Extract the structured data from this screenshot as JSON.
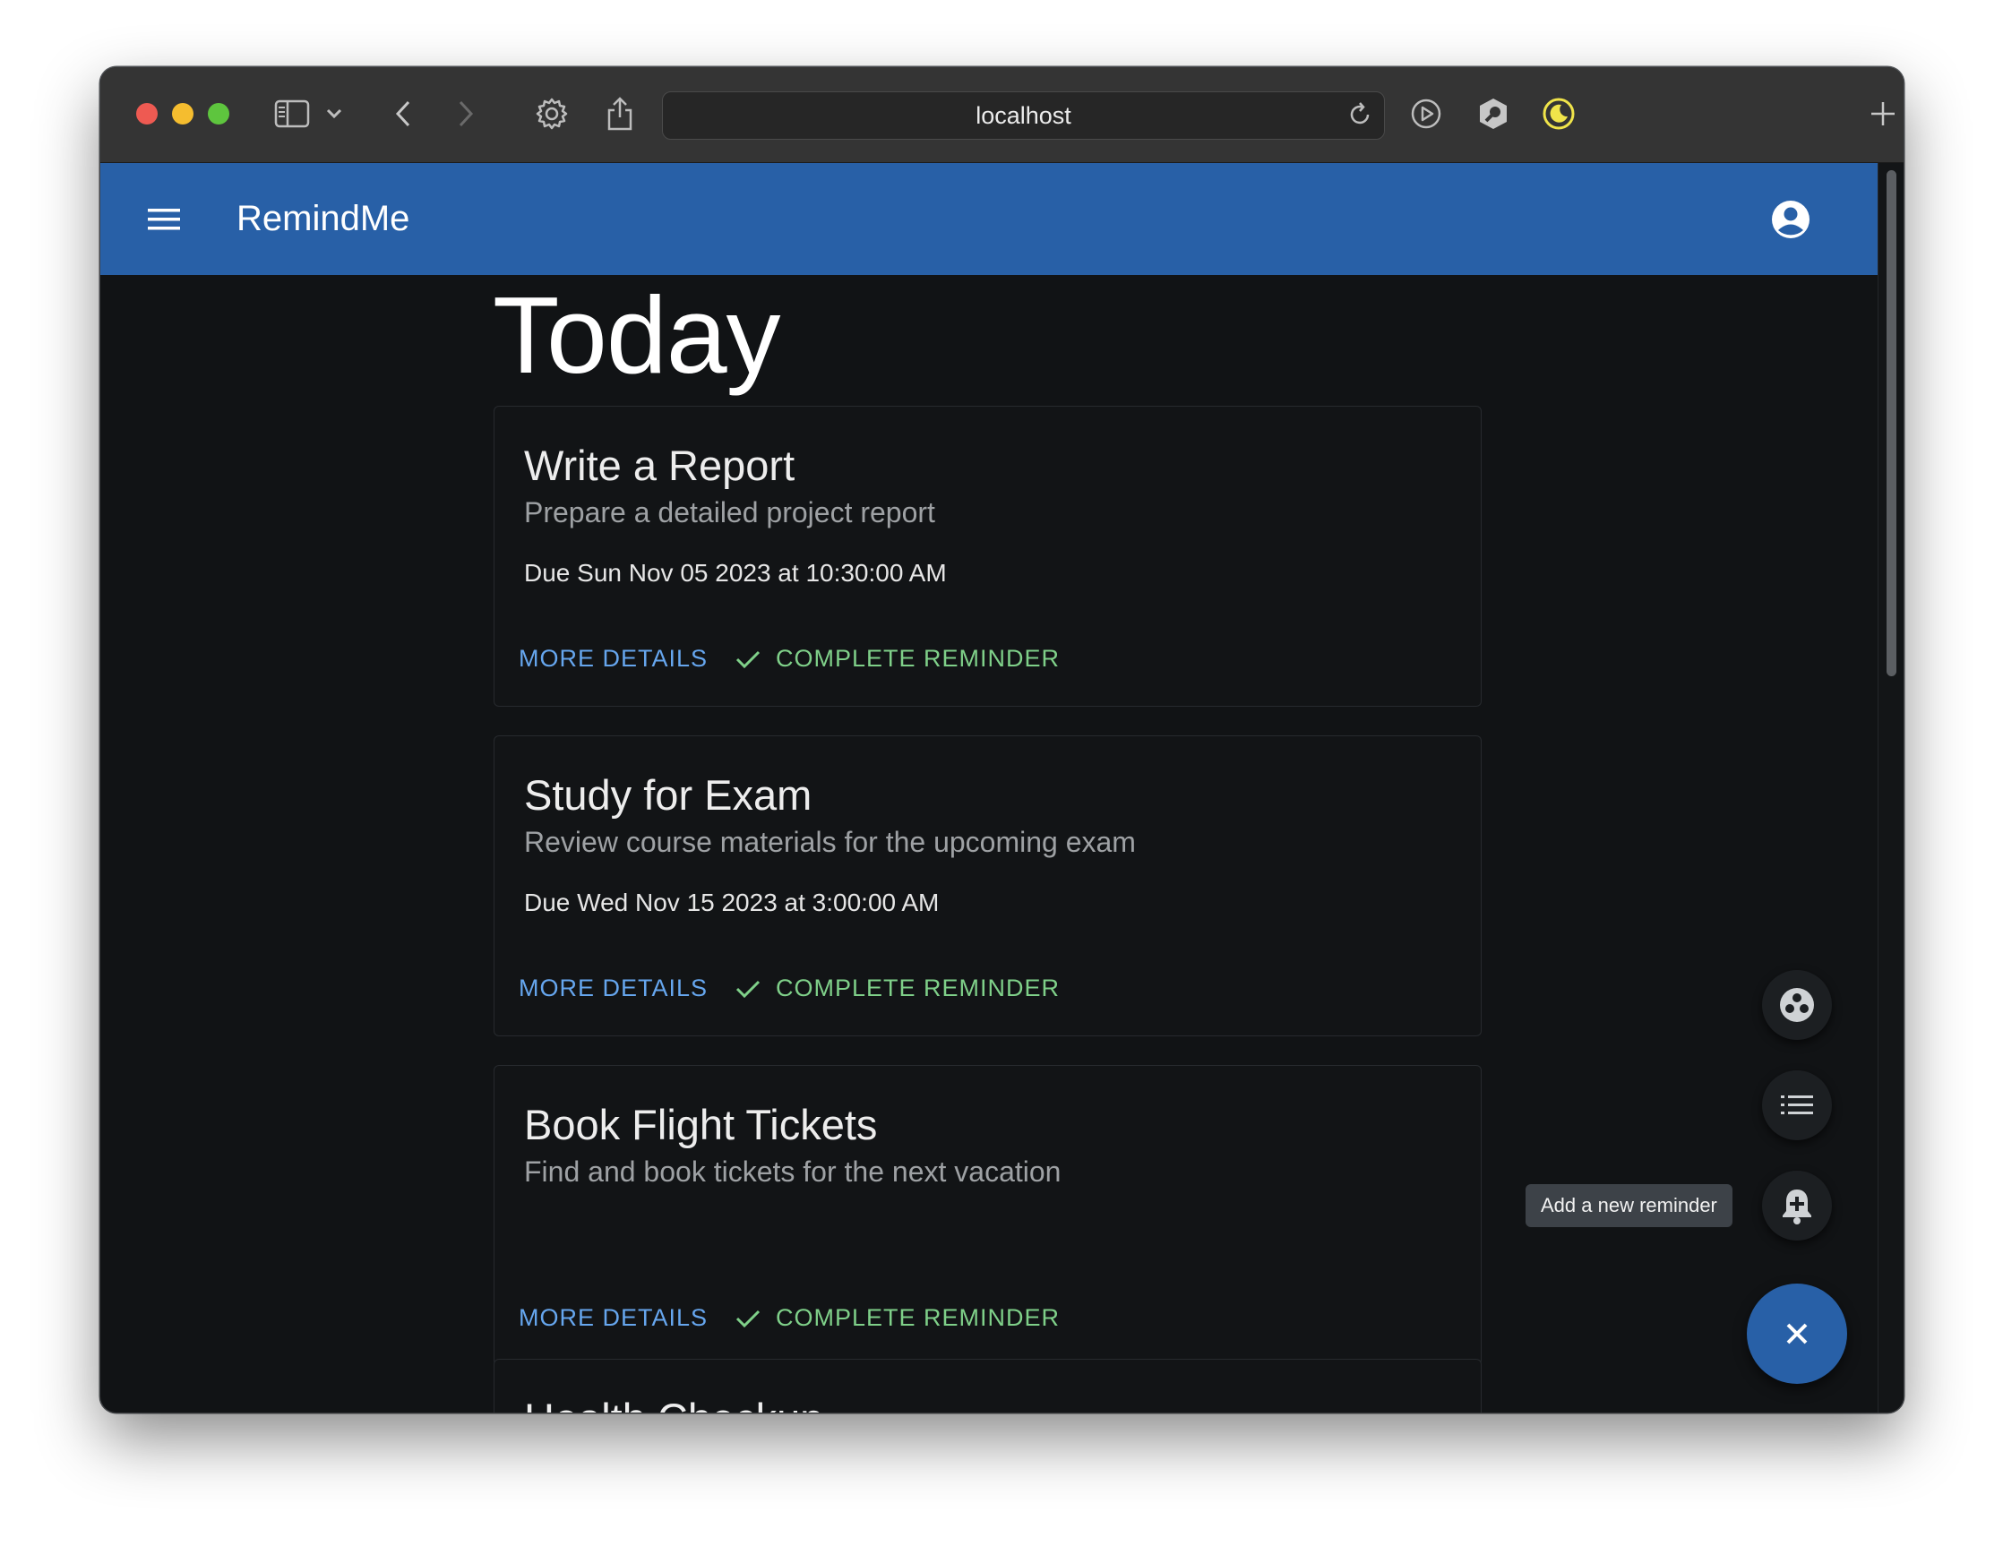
{
  "browser": {
    "url": "localhost"
  },
  "app": {
    "title": "RemindMe",
    "page_title": "Today"
  },
  "reminders": [
    {
      "title": "Write a Report",
      "description": "Prepare a detailed project report",
      "due": "Due Sun Nov 05 2023 at 10:30:00 AM",
      "more_label": "MORE DETAILS",
      "complete_label": "COMPLETE REMINDER"
    },
    {
      "title": "Study for Exam",
      "description": "Review course materials for the upcoming exam",
      "due": "Due Wed Nov 15 2023 at 3:00:00 AM",
      "more_label": "MORE DETAILS",
      "complete_label": "COMPLETE REMINDER"
    },
    {
      "title": "Book Flight Tickets",
      "description": "Find and book tickets for the next vacation",
      "due": "",
      "more_label": "MORE DETAILS",
      "complete_label": "COMPLETE REMINDER"
    },
    {
      "title": "Health Checkup"
    }
  ],
  "speed_dial": {
    "tooltip": "Add a new reminder",
    "actions": [
      "group-icon",
      "list-icon",
      "add-alert-icon"
    ],
    "close_icon": "close-icon"
  },
  "colors": {
    "appbar": "#2860a7",
    "background": "#111315",
    "link": "#66a6ee",
    "success": "#7fd089"
  }
}
